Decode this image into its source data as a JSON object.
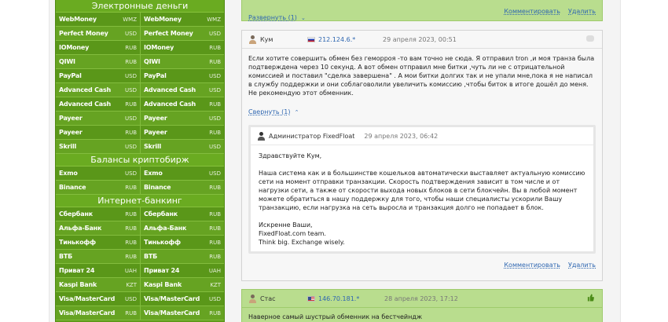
{
  "exchange_table": {
    "sections": [
      {
        "title": "Электронные деньги",
        "rows": [
          {
            "left_name": "WebMoney",
            "left_cur": "WMZ",
            "right_name": "WebMoney",
            "right_cur": "WMZ"
          },
          {
            "left_name": "Perfect Money",
            "left_cur": "USD",
            "right_name": "Perfect Money",
            "right_cur": "USD"
          },
          {
            "left_name": "IOMoney",
            "left_cur": "RUB",
            "right_name": "IOMoney",
            "right_cur": "RUB"
          },
          {
            "left_name": "QIWI",
            "left_cur": "RUB",
            "right_name": "QIWI",
            "right_cur": "RUB"
          },
          {
            "left_name": "PayPal",
            "left_cur": "USD",
            "right_name": "PayPal",
            "right_cur": "USD"
          },
          {
            "left_name": "Advanced Cash",
            "left_cur": "USD",
            "right_name": "Advanced Cash",
            "right_cur": "USD"
          },
          {
            "left_name": "Advanced Cash",
            "left_cur": "RUB",
            "right_name": "Advanced Cash",
            "right_cur": "RUB"
          },
          {
            "left_name": "Payeer",
            "left_cur": "USD",
            "right_name": "Payeer",
            "right_cur": "USD"
          },
          {
            "left_name": "Payeer",
            "left_cur": "RUB",
            "right_name": "Payeer",
            "right_cur": "RUB"
          },
          {
            "left_name": "Skrill",
            "left_cur": "USD",
            "right_name": "Skrill",
            "right_cur": "USD"
          }
        ]
      },
      {
        "title": "Балансы криптобирж",
        "rows": [
          {
            "left_name": "Exmo",
            "left_cur": "USD",
            "right_name": "Exmo",
            "right_cur": "USD"
          },
          {
            "left_name": "Binance",
            "left_cur": "RUB",
            "right_name": "Binance",
            "right_cur": "RUB"
          }
        ]
      },
      {
        "title": "Интернет-банкинг",
        "rows": [
          {
            "left_name": "Сбербанк",
            "left_cur": "RUB",
            "right_name": "Сбербанк",
            "right_cur": "RUB"
          },
          {
            "left_name": "Альфа-Банк",
            "left_cur": "RUB",
            "right_name": "Альфа-Банк",
            "right_cur": "RUB"
          },
          {
            "left_name": "Тинькофф",
            "left_cur": "RUB",
            "right_name": "Тинькофф",
            "right_cur": "RUB"
          },
          {
            "left_name": "ВТБ",
            "left_cur": "RUB",
            "right_name": "ВТБ",
            "right_cur": "RUB"
          },
          {
            "left_name": "Приват 24",
            "left_cur": "UAH",
            "right_name": "Приват 24",
            "right_cur": "UAH"
          },
          {
            "left_name": "Kaspi Bank",
            "left_cur": "KZT",
            "right_name": "Kaspi Bank",
            "right_cur": "KZT"
          },
          {
            "left_name": "Visa/MasterCard",
            "left_cur": "USD",
            "right_name": "Visa/MasterCard",
            "right_cur": "USD"
          },
          {
            "left_name": "Visa/MasterCard",
            "left_cur": "RUB",
            "right_name": "Visa/MasterCard",
            "right_cur": "RUB"
          }
        ]
      }
    ]
  },
  "top_comment": {
    "expand_label": "Развернуть (1)",
    "comment_label": "Комментировать",
    "delete_label": "Удалить"
  },
  "comment1": {
    "author": "Кум",
    "ip": "212.124.6.*",
    "date": "29 апреля 2023, 00:51",
    "text": "Если хотите совершить обмен без геморроя -то вам точно не сюда. Я отправил tron ,и моя транза была подтверждена через 10 секунд. А вот обмен отправил мне битки ,чуть ли не с отрицательной комиссией и поставил \"сделка завершена\" . А мои битки долгих так и не упали мне,пока я не написал в службу поддержки и они соблаговолили увеличить комиссию ,чтобы биток в итоге дошёл до меня. Не рекомендую этот обменник.",
    "collapse_label": "Свернуть (1)",
    "reply": {
      "author": "Администратор FixedFloat",
      "date": "29 апреля 2023, 06:42",
      "greeting": "Здравствуйте Кум,",
      "body": "Наша система как и в большинстве кошельков автоматически выставляет актуальную комиссию сети на момент отправки транзакции. Скорость подтверждения зависит в том числе и от нагрузки сети, а также от скорости выхода новых блоков в сети блокчейн. Вы в любой момент можете обратиться в нашу поддержку для того, чтобы наши специалисты ускорили Вашу транзакцию, если нагрузка на сеть выросла и транзакция долго не попадает в блок.",
      "sign1": "Искренне Ваши,",
      "sign2": "FixedFloat.com team.",
      "sign3": "Think big. Exchange wisely."
    },
    "comment_label": "Комментировать",
    "delete_label": "Удалить"
  },
  "comment2": {
    "author": "Стас",
    "ip": "146.70.181.*",
    "date": "28 апреля 2023, 17:12",
    "text": "Наверное самый шустрый обменник на бестчейндж"
  },
  "colors": {
    "table_green": "#5e9b1a",
    "positive_bg": "#b9dd8e",
    "link_blue": "#2f67b1"
  }
}
